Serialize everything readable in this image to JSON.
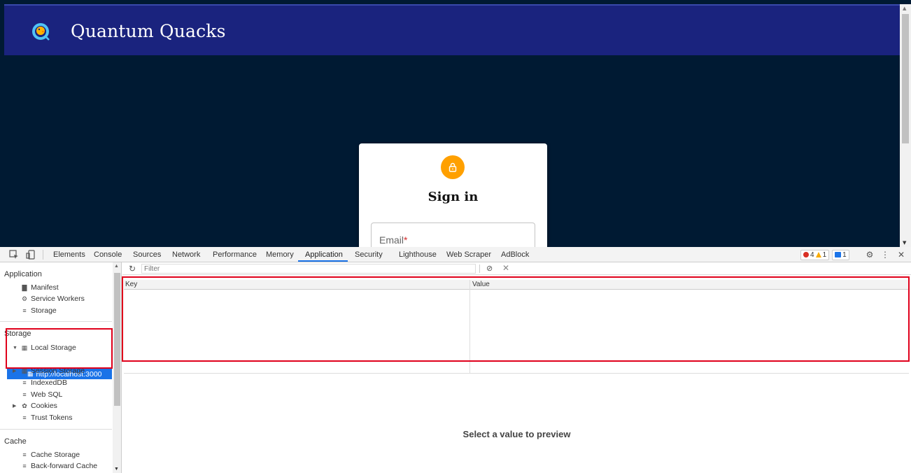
{
  "page": {
    "app_title": "Quantum Quacks",
    "signin_title": "Sign in",
    "email_label": "Email",
    "email_required_mark": "*",
    "icons": {
      "logo": "duck-logo-icon",
      "lock": "lock-icon"
    },
    "colors": {
      "header": "#1a237e",
      "body": "#001a33",
      "lock_avatar": "#ffa000"
    }
  },
  "devtools": {
    "tabs": [
      "Elements",
      "Console",
      "Sources",
      "Network",
      "Performance",
      "Memory",
      "Application",
      "Security",
      "Lighthouse",
      "Web Scraper",
      "AdBlock"
    ],
    "active_tab": "Application",
    "issues": {
      "errors": "4",
      "warnings": "1",
      "messages": "1"
    },
    "sidebar": {
      "application_section": "Application",
      "application_items": [
        "Manifest",
        "Service Workers",
        "Storage"
      ],
      "storage_section": "Storage",
      "local_storage": "Local Storage",
      "local_storage_origin": "http://localhost:3000",
      "storage_items": [
        "Session Storage",
        "IndexedDB",
        "Web SQL",
        "Cookies",
        "Trust Tokens"
      ],
      "cache_section": "Cache",
      "cache_items": [
        "Cache Storage",
        "Back-forward Cache"
      ]
    },
    "filter_placeholder": "Filter",
    "table_columns": {
      "key": "Key",
      "value": "Value"
    },
    "preview_message": "Select a value to preview",
    "accent_color": "#1a73e8",
    "highlight_color": "#e0001b"
  }
}
